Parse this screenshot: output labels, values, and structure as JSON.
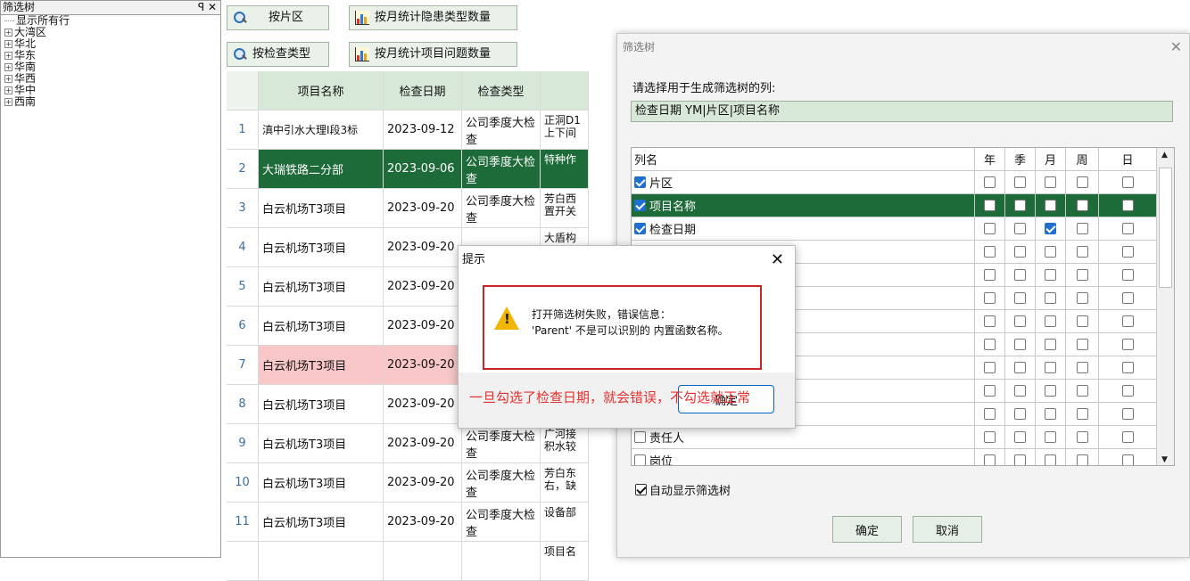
{
  "left_panel": {
    "title": "筛选树",
    "controls": "ꟼ ✕",
    "tree": [
      {
        "label": "显示所有行",
        "expandable": false
      },
      {
        "label": "大湾区",
        "expandable": true
      },
      {
        "label": "华北",
        "expandable": true
      },
      {
        "label": "华东",
        "expandable": true
      },
      {
        "label": "华南",
        "expandable": true
      },
      {
        "label": "华西",
        "expandable": true
      },
      {
        "label": "华中",
        "expandable": true
      },
      {
        "label": "西南",
        "expandable": true
      }
    ]
  },
  "toolbar": {
    "by_area": "按片区",
    "by_month_hazard": "按月统计隐患类型数量",
    "by_check_type": "按检查类型",
    "by_month_issue": "按月统计项目问题数量"
  },
  "grid": {
    "headers": [
      "项目名称",
      "检查日期",
      "检查类型",
      ""
    ],
    "rows": [
      {
        "num": "1",
        "name": "滇中引水大理Ⅰ段3标",
        "date": "2023-09-12",
        "type": "公司季度大检查",
        "extra": "正洞D1 上下间"
      },
      {
        "num": "2",
        "name": "大瑞铁路二分部",
        "date": "2023-09-06",
        "type": "公司季度大检查",
        "extra": "特种作"
      },
      {
        "num": "3",
        "name": "白云机场T3项目",
        "date": "2023-09-20",
        "type": "公司季度大检查",
        "extra": "芳白西 置开关"
      },
      {
        "num": "4",
        "name": "白云机场T3项目",
        "date": "2023-09-20",
        "type": "",
        "extra": "大盾构"
      },
      {
        "num": "5",
        "name": "白云机场T3项目",
        "date": "2023-09-20",
        "type": "",
        "extra": ""
      },
      {
        "num": "6",
        "name": "白云机场T3项目",
        "date": "2023-09-20",
        "type": "",
        "extra": ""
      },
      {
        "num": "7",
        "name": "白云机场T3项目",
        "date": "2023-09-20",
        "type": "",
        "extra": ""
      },
      {
        "num": "8",
        "name": "白云机场T3项目",
        "date": "2023-09-20",
        "type": "",
        "extra": ""
      },
      {
        "num": "9",
        "name": "白云机场T3项目",
        "date": "2023-09-20",
        "type": "公司季度大检查",
        "extra": "广河接 积水较"
      },
      {
        "num": "10",
        "name": "白云机场T3项目",
        "date": "2023-09-20",
        "type": "公司季度大检查",
        "extra": "芳白东 右，缺"
      },
      {
        "num": "11",
        "name": "白云机场T3项目",
        "date": "2023-09-20",
        "type": "公司季度大检查",
        "extra": "设备部"
      },
      {
        "num": "",
        "name": "",
        "date": "",
        "type": "",
        "extra": "项目名"
      }
    ]
  },
  "filter_dialog": {
    "title": "筛选树",
    "close": "✕",
    "prompt": "请选择用于生成筛选树的列:",
    "selected_value": "检查日期 YM|片区|项目名称",
    "table_headers": [
      "列名",
      "年",
      "季",
      "月",
      "周",
      "日"
    ],
    "rows": [
      {
        "label": "片区",
        "checked": true,
        "flags": [
          false,
          false,
          false,
          false,
          false
        ]
      },
      {
        "label": "项目名称",
        "checked": true,
        "flags": [
          false,
          false,
          false,
          false,
          false
        ],
        "selected": true
      },
      {
        "label": "检查日期",
        "checked": true,
        "flags": [
          false,
          false,
          true,
          false,
          false
        ]
      },
      {
        "label": "",
        "checked": false,
        "flags": [
          false,
          false,
          false,
          false,
          false
        ]
      },
      {
        "label": "",
        "checked": false,
        "flags": [
          false,
          false,
          false,
          false,
          false
        ]
      },
      {
        "label": "",
        "checked": false,
        "flags": [
          false,
          false,
          false,
          false,
          false
        ]
      },
      {
        "label": "",
        "checked": false,
        "flags": [
          false,
          false,
          false,
          false,
          false
        ]
      },
      {
        "label": "",
        "checked": false,
        "flags": [
          false,
          false,
          false,
          false,
          false
        ]
      },
      {
        "label": "",
        "checked": false,
        "flags": [
          false,
          false,
          false,
          false,
          false
        ]
      },
      {
        "label": "",
        "checked": false,
        "flags": [
          false,
          false,
          false,
          false,
          false
        ]
      },
      {
        "label": "",
        "checked": false,
        "flags": [
          false,
          false,
          false,
          false,
          false
        ]
      },
      {
        "label": "责任人",
        "checked": false,
        "flags": [
          false,
          false,
          false,
          false,
          false
        ]
      },
      {
        "label": "岗位",
        "checked": false,
        "flags": [
          false,
          false,
          false,
          false,
          false
        ]
      }
    ],
    "auto_show_label": "自动显示筛选树",
    "auto_show_checked": true,
    "ok_label": "确定",
    "cancel_label": "取消"
  },
  "alert": {
    "title": "提示",
    "close": "✕",
    "line1": "打开筛选树失败，错误信息：",
    "line2": "'Parent' 不是可以识别的 内置函数名称。",
    "ok_label": "确定",
    "note": "一旦勾选了检查日期，就会错误，不勾选就正常"
  },
  "colors": {
    "header_green": "#d8e8d8",
    "selected_green": "#1e6b3a",
    "row_pink": "#f9c7c7",
    "annotation_red": "#e83030"
  }
}
